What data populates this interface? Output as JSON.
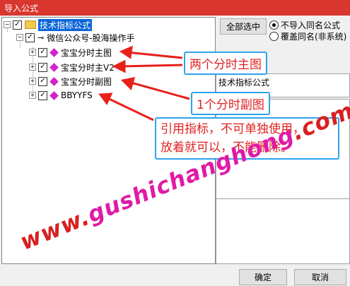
{
  "window": {
    "title": "导入公式"
  },
  "tree": {
    "root_label": "技术指标公式",
    "group_label": "微信公众号-股海操作手",
    "items": [
      {
        "label": "宝宝分时主图"
      },
      {
        "label": "宝宝分时主V2"
      },
      {
        "label": "宝宝分时副图"
      },
      {
        "label": "BBYYFS"
      }
    ]
  },
  "options": {
    "select_all_label": "全部选中",
    "radio1_label": "不导入同名公式",
    "radio2_label": "覆盖同名(非系统)",
    "selected_radio": "radio1"
  },
  "panel": {
    "header": "技术指标公式"
  },
  "annotations": {
    "callout1": "两个分时主图",
    "callout2": "1个分时副图",
    "callout3_line1": "引用指标，不可单独使用，",
    "callout3_line2": "放着就可以，不能删除。"
  },
  "watermark": {
    "text1": "www.",
    "text2": "gushichanghong",
    "text3": ".com"
  },
  "buttons": {
    "ok": "确定",
    "cancel": "取消"
  },
  "colors": {
    "titlebar": "#d9362f",
    "callout_border": "#2ea3ec",
    "callout_text": "#e02020",
    "arrow": "#e8201a"
  }
}
